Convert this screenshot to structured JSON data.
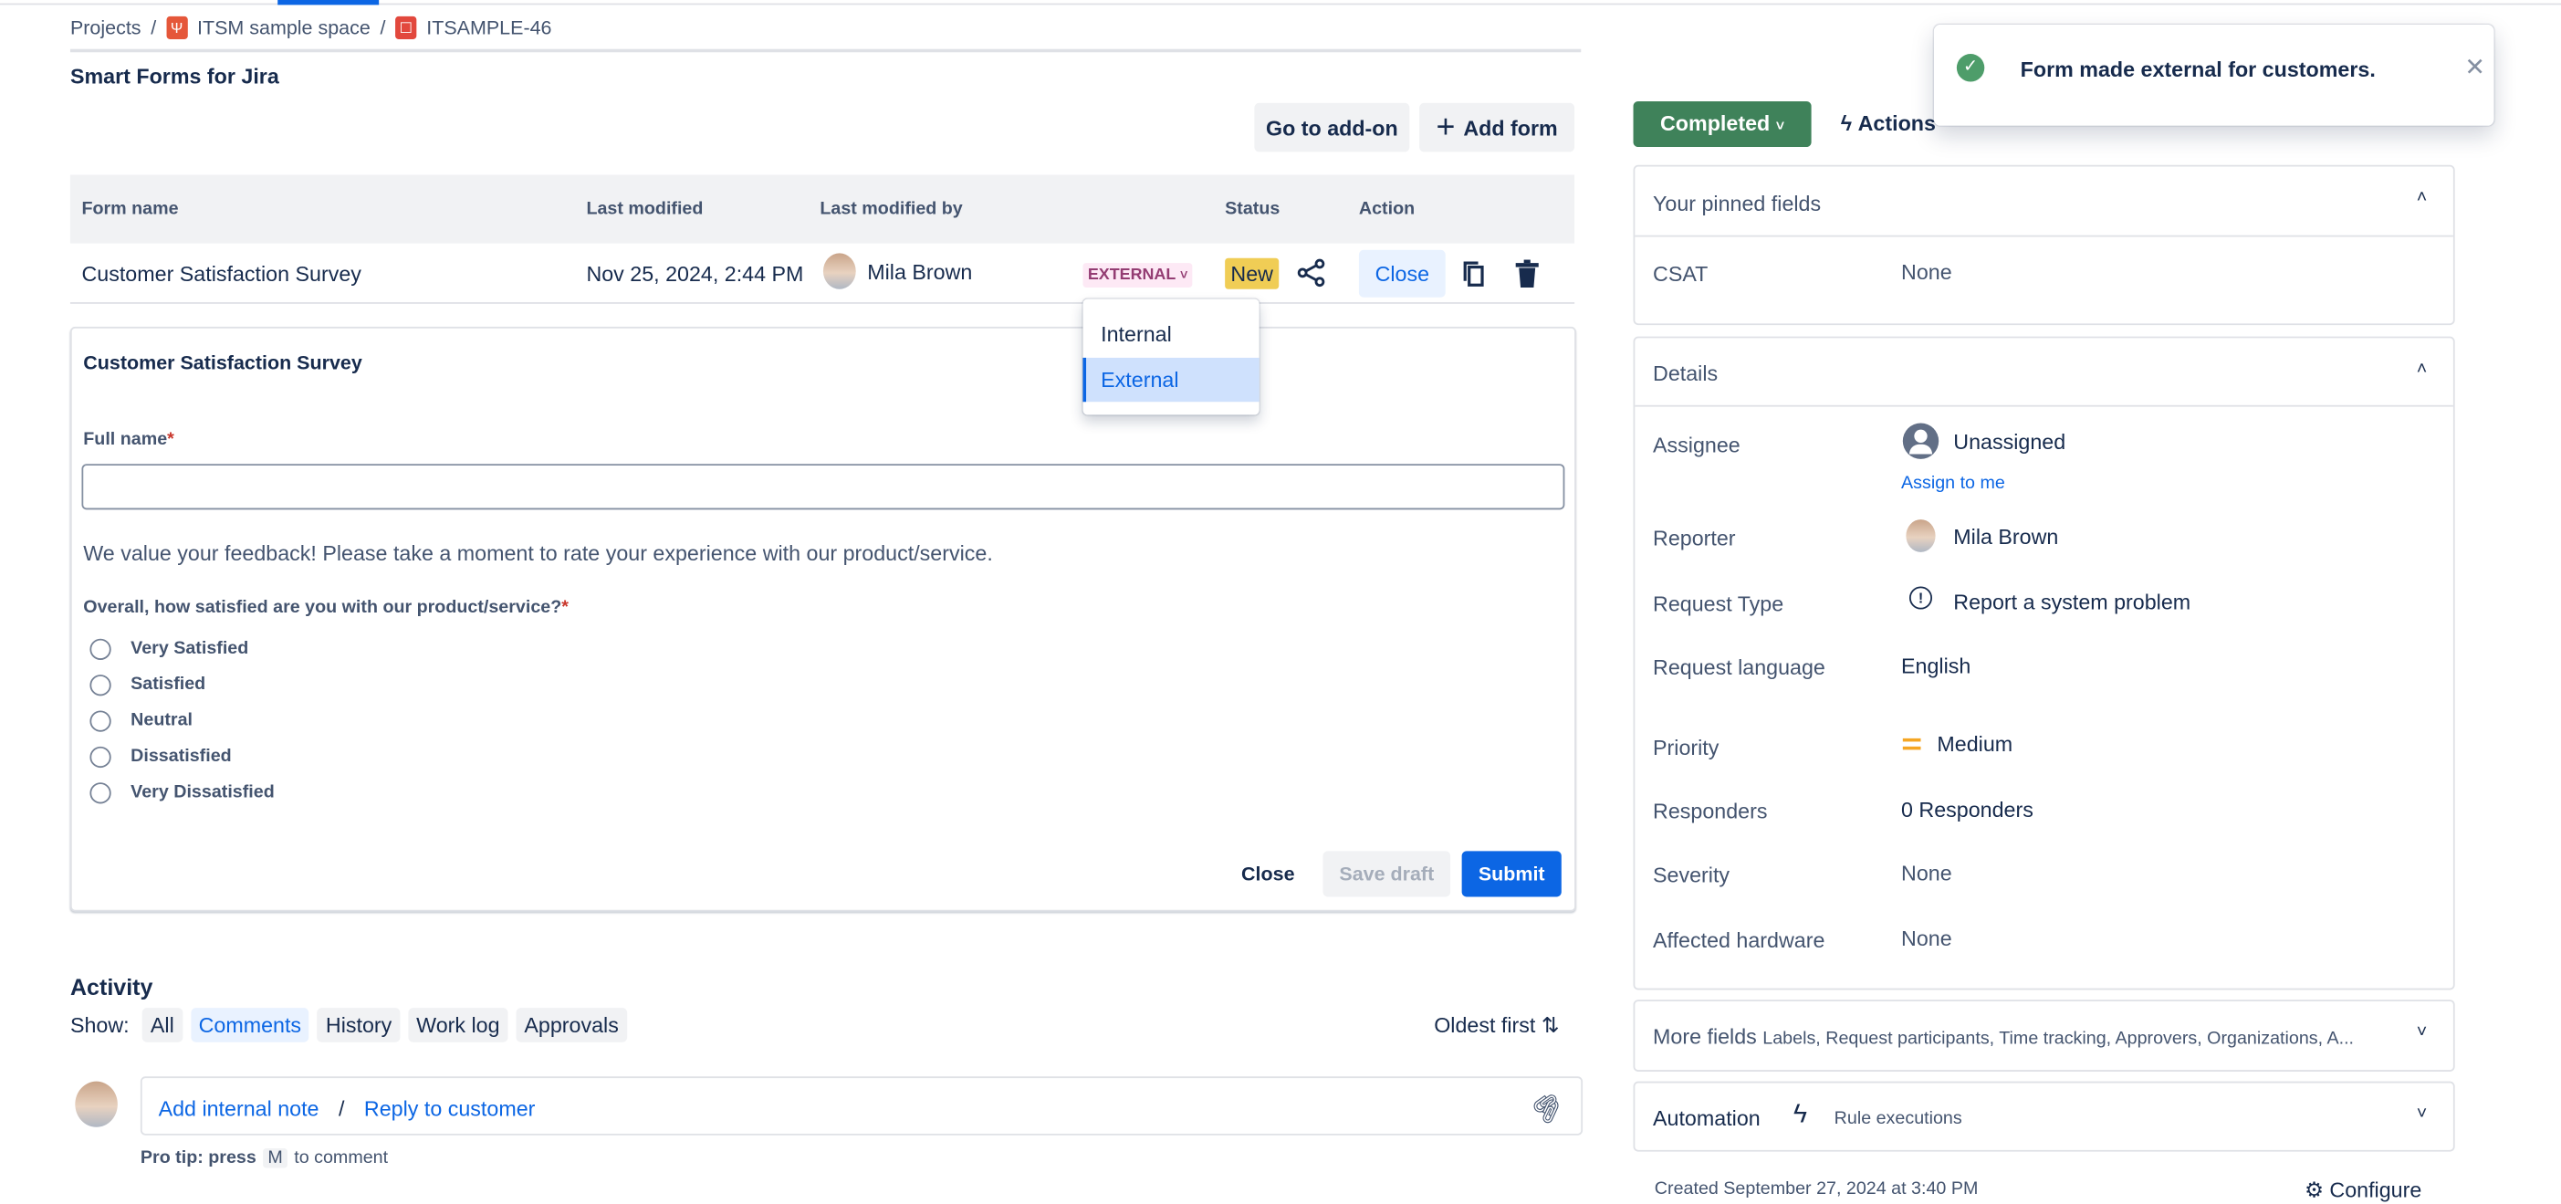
{
  "breadcrumb": {
    "projects": "Projects",
    "space": "ITSM sample space",
    "issue": "ITSAMPLE-46"
  },
  "app_title": "Smart Forms for Jira",
  "toolbar": {
    "go_to_addon": "Go to add-on",
    "add_form": "Add form"
  },
  "table": {
    "headers": [
      "Form name",
      "Last modified",
      "Last modified by",
      "Status",
      "Action"
    ],
    "row": {
      "name": "Customer Satisfaction Survey",
      "modified": "Nov 25, 2024, 2:44 PM",
      "by": "Mila Brown",
      "visibility": "EXTERNAL",
      "status": "New",
      "close": "Close"
    }
  },
  "visibility_menu": {
    "options": [
      "Internal",
      "External"
    ],
    "selected": "External"
  },
  "form": {
    "title": "Customer Satisfaction Survey",
    "full_name_label": "Full name",
    "full_name_value": "",
    "intro": "We value your feedback! Please take a moment to rate your experience with our product/service.",
    "question": "Overall, how satisfied are you with our product/service?",
    "options": [
      "Very Satisfied",
      "Satisfied",
      "Neutral",
      "Dissatisfied",
      "Very Dissatisfied"
    ],
    "close": "Close",
    "save_draft": "Save draft",
    "submit": "Submit"
  },
  "activity": {
    "title": "Activity",
    "show": "Show:",
    "filters": [
      "All",
      "Comments",
      "History",
      "Work log",
      "Approvals"
    ],
    "active_filter": "Comments",
    "sort": "Oldest first",
    "add_note": "Add internal note",
    "slash": "/",
    "reply": "Reply to customer",
    "tip_pre": "Pro tip: press",
    "tip_key": "M",
    "tip_post": "to comment"
  },
  "status_button": "Completed",
  "actions_button": "Actions",
  "toast": {
    "message": "Form made external for customers."
  },
  "pinned": {
    "title": "Your pinned fields",
    "fields": [
      {
        "label": "CSAT",
        "value": "None"
      }
    ]
  },
  "details": {
    "title": "Details",
    "assignee_label": "Assignee",
    "assignee": "Unassigned",
    "assign_to_me": "Assign to me",
    "reporter_label": "Reporter",
    "reporter": "Mila Brown",
    "request_type_label": "Request Type",
    "request_type": "Report a system problem",
    "language_label": "Request language",
    "language": "English",
    "priority_label": "Priority",
    "priority": "Medium",
    "responders_label": "Responders",
    "responders": "0 Responders",
    "severity_label": "Severity",
    "severity": "None",
    "hardware_label": "Affected hardware",
    "hardware": "None"
  },
  "more_fields": {
    "title": "More fields",
    "summary": "Labels, Request participants, Time tracking, Approvers, Organizations, A..."
  },
  "automation": {
    "title": "Automation",
    "sub": "Rule executions"
  },
  "footer": {
    "created": "Created September 27, 2024 at 3:40 PM",
    "configure": "Configure"
  },
  "colors": {
    "accent": "#0c66e4",
    "completed": "#3f825a",
    "success": "#4e9d6a",
    "new_badge": "#f0cd55"
  }
}
